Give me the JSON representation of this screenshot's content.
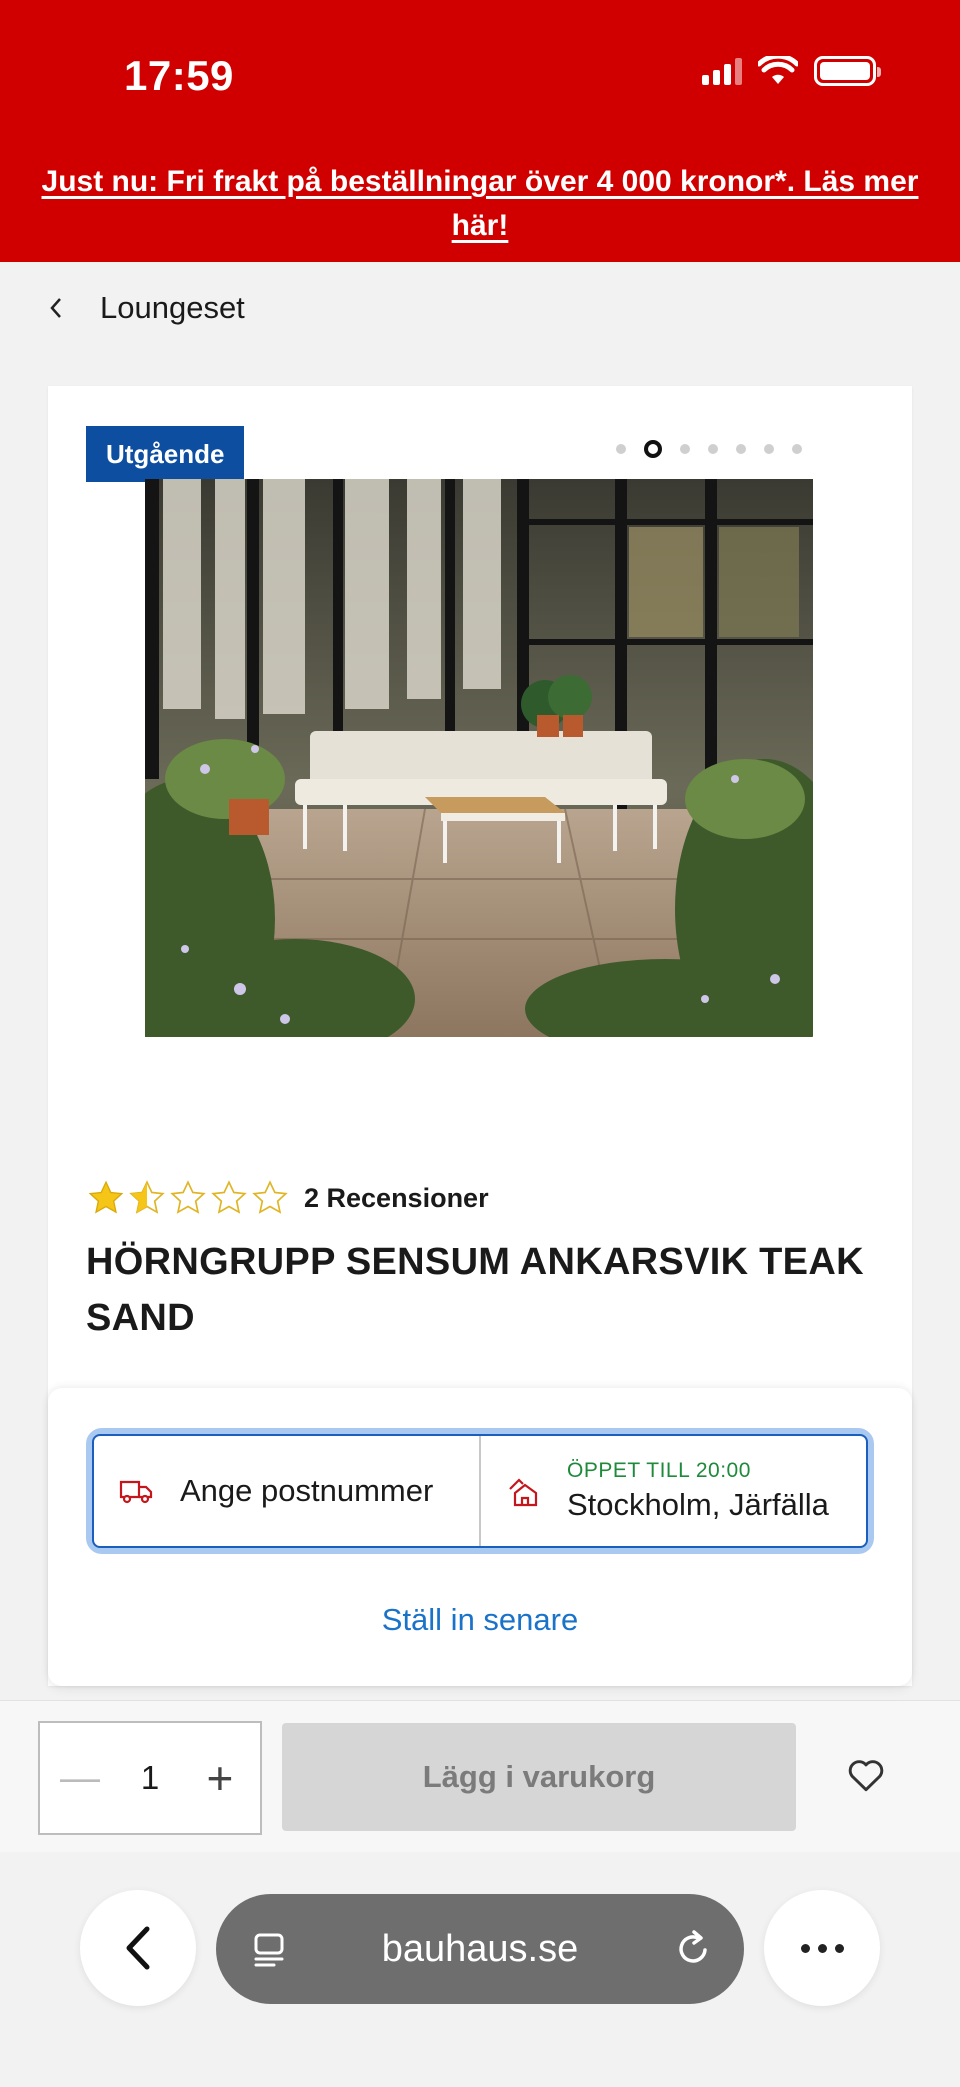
{
  "status_bar": {
    "time": "17:59",
    "battery_level": 1.0,
    "signal_bars": 3
  },
  "promo": {
    "text": "Just nu: Fri frakt på beställningar över 4 000 kronor*. Läs mer här!"
  },
  "breadcrumb": {
    "back_icon": "chevron-left-icon",
    "label": "Loungeset"
  },
  "product": {
    "badge": "Utgående",
    "carousel": {
      "total": 7,
      "active_index": 1
    },
    "rating": {
      "value": 1.5,
      "max": 5,
      "reviews_label": "2 Recensioner"
    },
    "title": "HÖRNGRUPP SENSUM ANKARSVIK TEAK SAND"
  },
  "delivery": {
    "postcode_label": "Ange postnummer",
    "store_hours": "ÖPPET TILL 20:00",
    "store_name": "Stockholm, Järfälla",
    "set_later": "Ställ in senare"
  },
  "purchase": {
    "quantity": "1",
    "add_to_cart": "Lägg i varukorg"
  },
  "browser": {
    "url": "bauhaus.se"
  },
  "colors": {
    "brand_red": "#d00000",
    "badge_blue": "#0d4ea1",
    "link_blue": "#1a73c9",
    "open_green": "#1e8a3a",
    "star_yellow": "#f5c518"
  }
}
